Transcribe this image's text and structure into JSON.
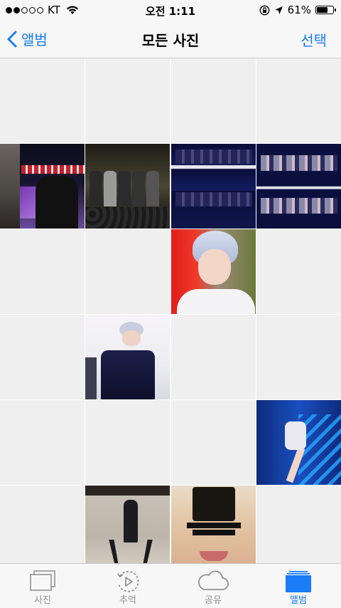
{
  "status_bar": {
    "carrier": "KT",
    "time": "오전 1:11",
    "battery_percent": "61%",
    "battery_level": 0.61
  },
  "nav": {
    "back_label": "앨범",
    "title": "모든 사진",
    "select_label": "선택"
  },
  "grid": {
    "columns": 4,
    "cells": [
      {
        "thumb": "empty"
      },
      {
        "thumb": "empty"
      },
      {
        "thumb": "empty"
      },
      {
        "thumb": "empty"
      },
      {
        "thumb": "stage-performance"
      },
      {
        "thumb": "group-on-stage"
      },
      {
        "thumb": "group-collage"
      },
      {
        "thumb": "group-collage"
      },
      {
        "thumb": "empty"
      },
      {
        "thumb": "empty"
      },
      {
        "thumb": "member-closeup-red-background"
      },
      {
        "thumb": "empty"
      },
      {
        "thumb": "empty"
      },
      {
        "thumb": "member-dark-jacket"
      },
      {
        "thumb": "empty"
      },
      {
        "thumb": "empty"
      },
      {
        "thumb": "empty"
      },
      {
        "thumb": "empty"
      },
      {
        "thumb": "empty"
      },
      {
        "thumb": "member-jumping-blue-background"
      },
      {
        "thumb": "empty"
      },
      {
        "thumb": "dance-practice"
      },
      {
        "thumb": "show-me-the-money-closeup"
      },
      {
        "thumb": "empty"
      }
    ]
  },
  "tab_bar": {
    "active_tab": "앨범",
    "tabs": [
      {
        "label": "사진",
        "icon": "photos-icon"
      },
      {
        "label": "추억",
        "icon": "memories-icon"
      },
      {
        "label": "공유",
        "icon": "cloud-share-icon"
      },
      {
        "label": "앨범",
        "icon": "albums-icon"
      }
    ]
  },
  "colors": {
    "accent": "#1a7cf6",
    "inactive": "#929292",
    "bar_background": "#f7f7f7",
    "empty_cell": "#efefef"
  }
}
